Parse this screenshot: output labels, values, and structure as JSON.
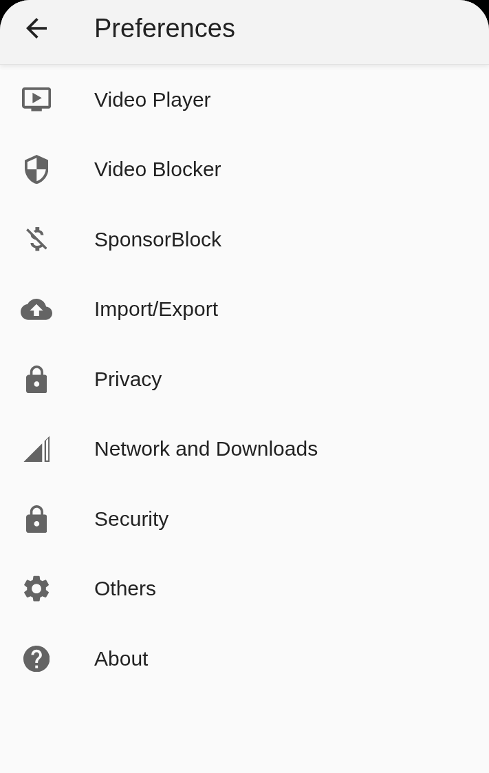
{
  "app_bar": {
    "title": "Preferences"
  },
  "items": [
    {
      "label": "Video Player"
    },
    {
      "label": "Video Blocker"
    },
    {
      "label": "SponsorBlock"
    },
    {
      "label": "Import/Export"
    },
    {
      "label": "Privacy"
    },
    {
      "label": "Network and Downloads"
    },
    {
      "label": "Security"
    },
    {
      "label": "Others"
    },
    {
      "label": "About"
    }
  ]
}
